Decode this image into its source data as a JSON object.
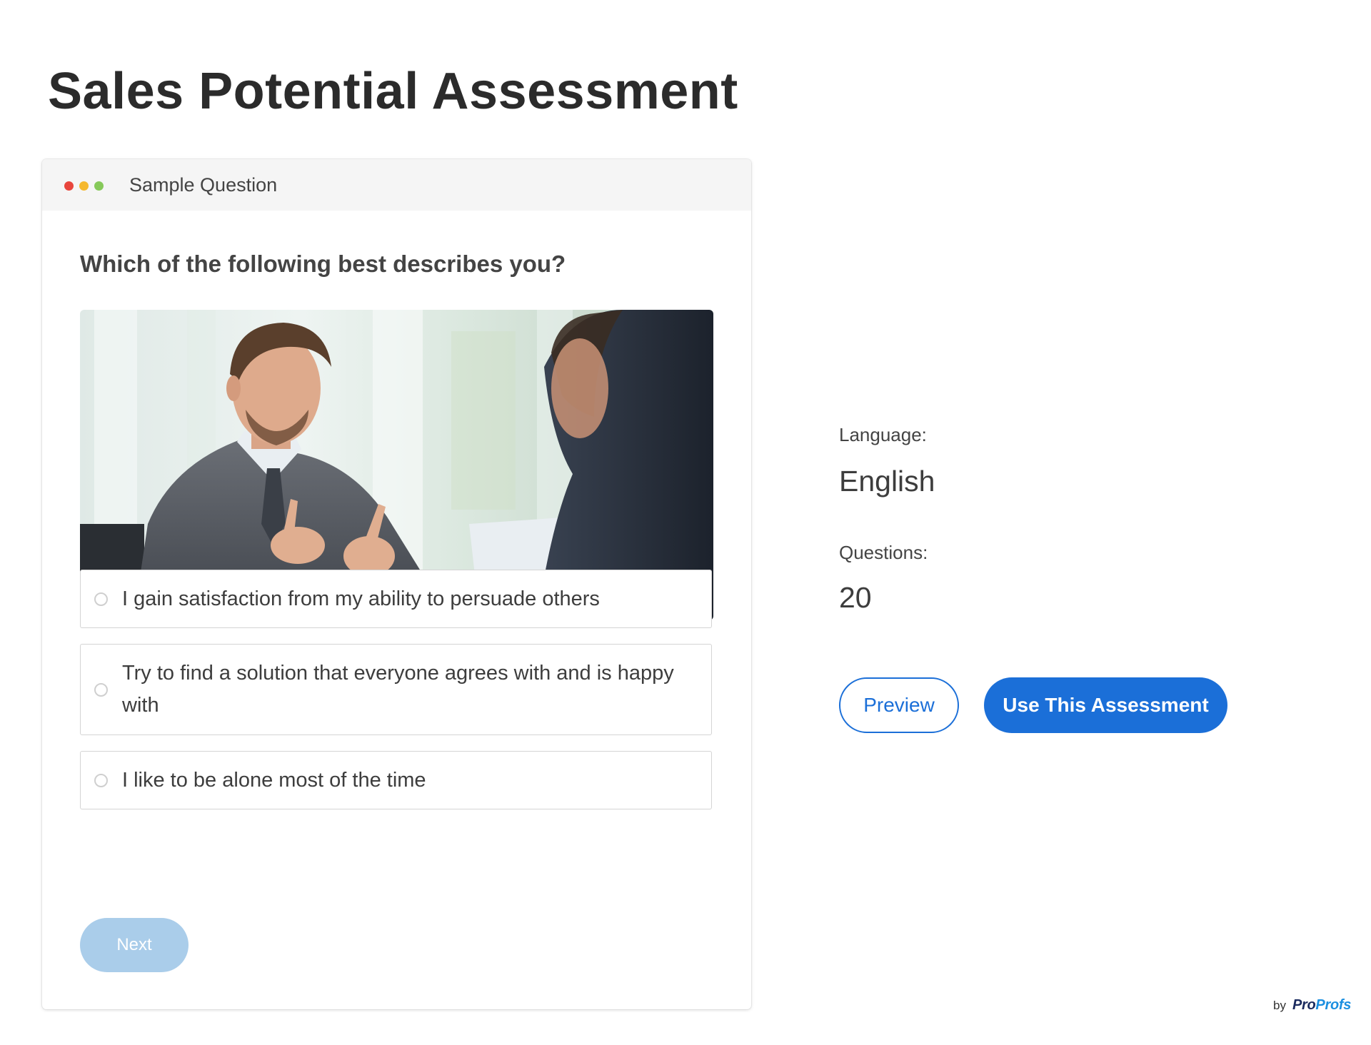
{
  "page": {
    "title": "Sales Potential Assessment"
  },
  "card": {
    "header_title": "Sample Question",
    "window_dots": [
      {
        "name": "close",
        "color": "#e8453c"
      },
      {
        "name": "minimize",
        "color": "#f5b82e"
      },
      {
        "name": "maximize",
        "color": "#86c95a"
      }
    ],
    "question": "Which of the following best describes you?",
    "image": {
      "icon": "photo-two-businessmen-meeting"
    },
    "options": [
      {
        "label": "I gain satisfaction from my ability to persuade others",
        "selected": false
      },
      {
        "label": "Try to find a solution that everyone agrees with and is happy with",
        "selected": false
      },
      {
        "label": "I like to be alone most of the time",
        "selected": false
      }
    ],
    "next_label": "Next"
  },
  "info": {
    "language_label": "Language:",
    "language_value": "English",
    "questions_label": "Questions:",
    "questions_value": "20"
  },
  "actions": {
    "preview_label": "Preview",
    "use_label": "Use This Assessment"
  },
  "brand": {
    "by": "by",
    "logo_part1": "Pro",
    "logo_part2": "Profs"
  },
  "colors": {
    "accent": "#1b6fd8",
    "next_disabled": "#aacdea",
    "title_text": "#2b2b2b"
  }
}
